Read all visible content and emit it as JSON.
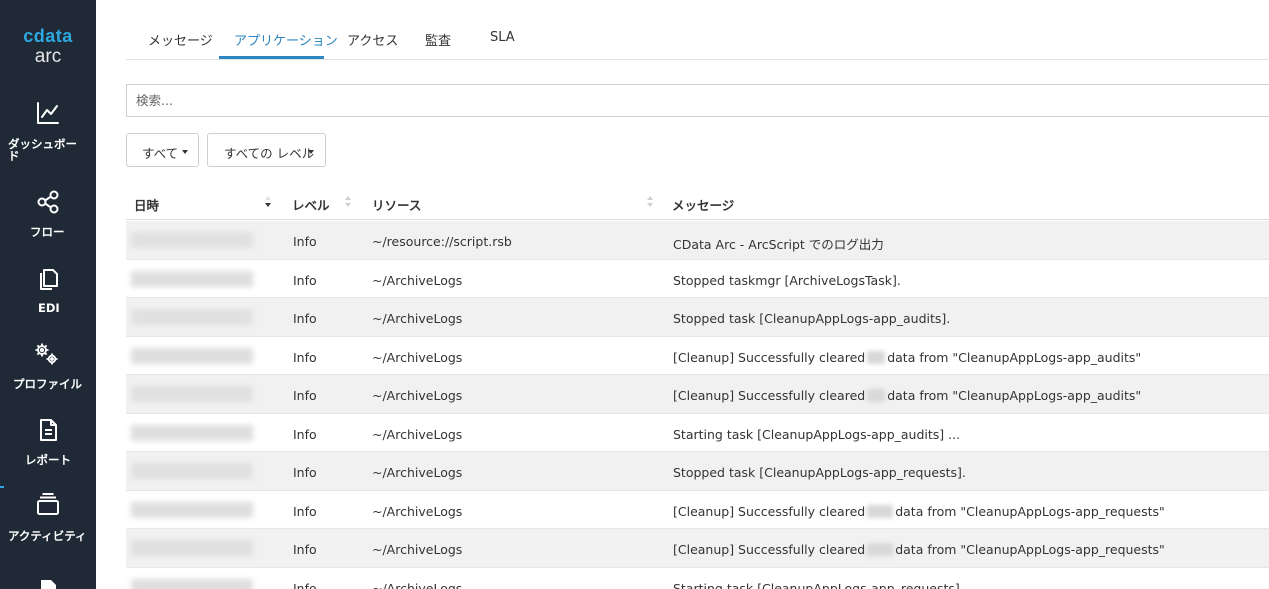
{
  "app": {
    "brand": "cdata",
    "product": "arc"
  },
  "sidebar": {
    "items": [
      {
        "label": "ダッシュボード",
        "icon": "chart-line-icon"
      },
      {
        "label": "フロー",
        "icon": "share-nodes-icon"
      },
      {
        "label": "EDI",
        "icon": "copy-documents-icon"
      },
      {
        "label": "プロファイル",
        "icon": "gears-icon"
      },
      {
        "label": "レポート",
        "icon": "file-text-icon"
      },
      {
        "label": "アクティビティ",
        "icon": "layers-stack-icon",
        "active": true
      }
    ]
  },
  "tabs": [
    {
      "label": "メッセージ"
    },
    {
      "label": "アプリケーション",
      "active": true
    },
    {
      "label": "アクセス"
    },
    {
      "label": "監査"
    },
    {
      "label": "SLA"
    }
  ],
  "search": {
    "placeholder": "検索...",
    "value": ""
  },
  "filters": {
    "type_filter": "すべて",
    "level_filter": "すべての レベル"
  },
  "table": {
    "columns": {
      "datetime": "日時",
      "level": "レベル",
      "resource": "リソース",
      "message": "メッセージ"
    },
    "sort": {
      "column": "datetime",
      "direction": "desc"
    },
    "rows": [
      {
        "level": "Info",
        "resource": "~/resource://script.rsb",
        "message": "CData Arc - ArcScript でのログ出力"
      },
      {
        "level": "Info",
        "resource": "~/ArchiveLogs",
        "message": "Stopped taskmgr [ArchiveLogsTask]."
      },
      {
        "level": "Info",
        "resource": "~/ArchiveLogs",
        "message": "Stopped task [CleanupAppLogs-app_audits]."
      },
      {
        "level": "Info",
        "resource": "~/ArchiveLogs",
        "message_pre": "[Cleanup] Successfully cleared",
        "message_post": "data from \"CleanupAppLogs-app_audits\""
      },
      {
        "level": "Info",
        "resource": "~/ArchiveLogs",
        "message_pre": "[Cleanup] Successfully cleared",
        "message_post": "data from \"CleanupAppLogs-app_audits\""
      },
      {
        "level": "Info",
        "resource": "~/ArchiveLogs",
        "message": "Starting task [CleanupAppLogs-app_audits] ..."
      },
      {
        "level": "Info",
        "resource": "~/ArchiveLogs",
        "message": "Stopped task [CleanupAppLogs-app_requests]."
      },
      {
        "level": "Info",
        "resource": "~/ArchiveLogs",
        "message_pre": "[Cleanup] Successfully cleared",
        "message_post": "data from \"CleanupAppLogs-app_requests\""
      },
      {
        "level": "Info",
        "resource": "~/ArchiveLogs",
        "message_pre": "[Cleanup] Successfully cleared",
        "message_post": "data from \"CleanupAppLogs-app_requests\""
      },
      {
        "level": "Info",
        "resource": "~/ArchiveLogs",
        "message": "Starting task [CleanupAppLogs-app_requests]..."
      }
    ]
  },
  "colors": {
    "sidebar_bg": "#1f2a36",
    "accent": "#2e86c1",
    "brand": "#2ea8e0",
    "row_alt": "#f1f1f1"
  }
}
